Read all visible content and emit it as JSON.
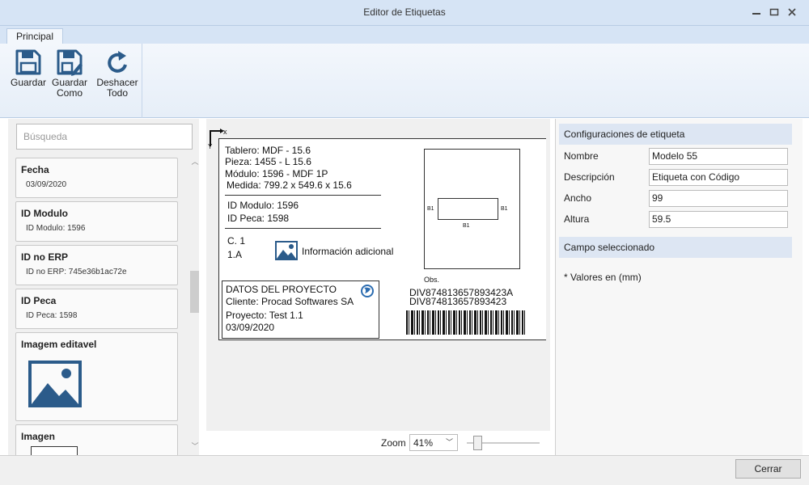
{
  "window": {
    "title": "Editor de Etiquetas"
  },
  "ribbon": {
    "tab": "Principal",
    "buttons": [
      {
        "line1": "Guardar",
        "line2": ""
      },
      {
        "line1": "Guardar",
        "line2": "Como"
      },
      {
        "line1": "Deshacer",
        "line2": "Todo"
      }
    ]
  },
  "left_panel": {
    "search_placeholder": "Búsqueda",
    "fields": [
      {
        "title": "Fecha",
        "value": "03/09/2020"
      },
      {
        "title": "ID Modulo",
        "value": "ID Modulo: 1596"
      },
      {
        "title": "ID no ERP",
        "value": "ID no ERP: 745e36b1ac72e"
      },
      {
        "title": "ID Peca",
        "value": "ID Peca: 1598"
      },
      {
        "title": "Imagem editavel",
        "value": ""
      },
      {
        "title": "Imagen",
        "value": ""
      }
    ]
  },
  "label": {
    "axis_x": "x",
    "axis_y": "Y",
    "lines": [
      "Tablero: MDF - 15.6",
      "Pieza: 1455 - L 15.6",
      "Módulo: 1596 - MDF 1P",
      "Medida: 799.2 x 549.6 x 15.6"
    ],
    "id_modulo": "ID Modulo: 1596",
    "id_peca": "ID Peca: 1598",
    "c1": "C. 1",
    "pos": "1.A",
    "info": "Información adicional",
    "project": {
      "title": "DATOS DEL PROYECTO",
      "client": "Cliente: Procad Softwares SA",
      "project": "Proyecto: Test 1.1",
      "date": "03/09/2020"
    },
    "edge_left": "B1",
    "edge_right": "B1",
    "edge_bottom": "B1",
    "obs": "Obs.",
    "code1": "DIV874813657893423A",
    "code2": "DIV874813657893423"
  },
  "zoom": {
    "label": "Zoom",
    "value": "41%"
  },
  "properties": {
    "section1": "Configuraciones de etiqueta",
    "nombre_label": "Nombre",
    "nombre_value": "Modelo 55",
    "descripcion_label": "Descripción",
    "descripcion_value": "Etiqueta con Código",
    "ancho_label": "Ancho",
    "ancho_value": "99",
    "altura_label": "Altura",
    "altura_value": "59.5",
    "section2": "Campo seleccionado",
    "note": "* Valores en (mm)"
  },
  "footer": {
    "close": "Cerrar"
  },
  "colors": {
    "accent": "#2b5b8a",
    "titlebar": "#d6e4f5",
    "section": "#dde6f3"
  },
  "icons": [
    "save-icon",
    "save-as-icon",
    "undo-all-icon",
    "image-icon",
    "globe-icon",
    "minimize-icon",
    "maximize-icon",
    "close-icon"
  ]
}
